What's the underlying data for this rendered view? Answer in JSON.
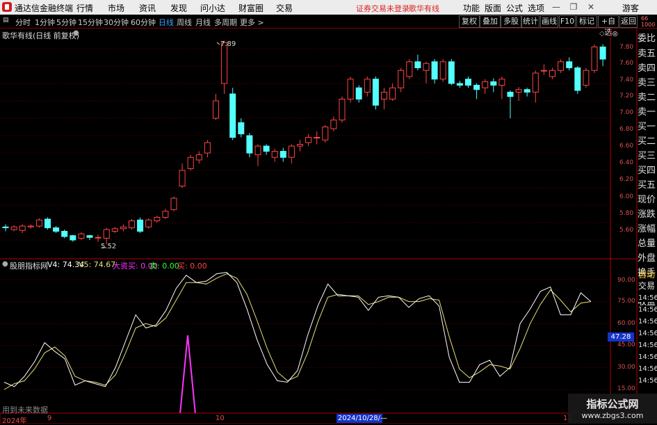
{
  "titlebar": {
    "app_title": "通达信金融终端",
    "menus": [
      "行情",
      "市场",
      "资讯",
      "发现",
      "问小达",
      "财富圈",
      "交易"
    ],
    "notice": "证券交易未登录",
    "stock_name": "歌华有线",
    "right_menus": [
      "功能",
      "版面",
      "公式",
      "选项"
    ],
    "user": "游客"
  },
  "toolbar": {
    "periods": [
      "分时",
      "1分钟",
      "5分钟",
      "15分钟",
      "30分钟",
      "60分钟",
      "日线",
      "周线",
      "月线",
      "多周期",
      "更多 >"
    ],
    "active_period": "日线",
    "right_buttons": [
      "复权",
      "叠加",
      "多股",
      "统计",
      "画线",
      "F10",
      "标记",
      "+自选",
      "返回"
    ]
  },
  "main_chart": {
    "caption": "歌华有线(日线 前复权)",
    "high_label": "7.89",
    "low_label": "5.52",
    "ytick_labels": [
      "7.80",
      "7.60",
      "7.40",
      "7.20",
      "7.00",
      "6.80",
      "6.60",
      "6.40",
      "6.20",
      "6.00",
      "5.80",
      "5.60"
    ]
  },
  "side_panel": {
    "labels": [
      "委比",
      "卖五",
      "卖四",
      "卖三",
      "卖二",
      "卖一",
      "买一",
      "买二",
      "买三",
      "买四",
      "买五",
      "现价",
      "涨跌",
      "涨幅",
      "总量",
      "外盘",
      "换手",
      "净资",
      "收益"
    ],
    "auto": "自动",
    "trade": "交易",
    "time_labels": [
      "14:56",
      "14:56",
      "14:56",
      "14:56",
      "14:56",
      "14:56",
      "14:56",
      "14:56"
    ]
  },
  "indicator": {
    "name": "股朋指标网",
    "v4_label": "V4: 74.34",
    "v5_label": "V5: 74.67",
    "big_buy": "大资买: 0.00",
    "sell": "卖: 0.00",
    "buy": "买: 0.00",
    "ytick_labels": [
      "90.00",
      "75.00",
      "60.00",
      "45.00",
      "30.00",
      "15.00"
    ],
    "current_value": "47.28",
    "footer": "用到未来数据"
  },
  "xaxis": {
    "labels": [
      "2024年",
      "9",
      "10",
      "2024/10/28/—",
      "12"
    ]
  },
  "watermark": {
    "title": "指标公式网",
    "url": "www.zbgs3.com"
  },
  "colors": {
    "up": "#ff4444",
    "down": "#54ffff",
    "v4": "#ffffff",
    "v5": "#e8e07a",
    "spike": "#ff33ff",
    "grid": "#6a0000"
  },
  "chart_data": {
    "type": "candlestick",
    "ylim": [
      5.5,
      7.95
    ],
    "candles": [
      {
        "o": 5.75,
        "c": 5.74,
        "h": 5.78,
        "l": 5.7
      },
      {
        "o": 5.72,
        "c": 5.75,
        "h": 5.77,
        "l": 5.7
      },
      {
        "o": 5.71,
        "c": 5.76,
        "h": 5.78,
        "l": 5.68
      },
      {
        "o": 5.75,
        "c": 5.76,
        "h": 5.78,
        "l": 5.73
      },
      {
        "o": 5.76,
        "c": 5.83,
        "h": 5.85,
        "l": 5.74
      },
      {
        "o": 5.84,
        "c": 5.74,
        "h": 5.86,
        "l": 5.72
      },
      {
        "o": 5.74,
        "c": 5.7,
        "h": 5.76,
        "l": 5.68
      },
      {
        "o": 5.7,
        "c": 5.64,
        "h": 5.72,
        "l": 5.62
      },
      {
        "o": 5.65,
        "c": 5.6,
        "h": 5.66,
        "l": 5.58
      },
      {
        "o": 5.62,
        "c": 5.67,
        "h": 5.69,
        "l": 5.6
      },
      {
        "o": 5.65,
        "c": 5.63,
        "h": 5.66,
        "l": 5.6
      },
      {
        "o": 5.63,
        "c": 5.63,
        "h": 5.66,
        "l": 5.58
      },
      {
        "o": 5.62,
        "c": 5.72,
        "h": 5.74,
        "l": 5.55
      },
      {
        "o": 5.7,
        "c": 5.73,
        "h": 5.75,
        "l": 5.68
      },
      {
        "o": 5.73,
        "c": 5.75,
        "h": 5.78,
        "l": 5.7
      },
      {
        "o": 5.74,
        "c": 5.82,
        "h": 5.84,
        "l": 5.72
      },
      {
        "o": 5.83,
        "c": 5.7,
        "h": 5.86,
        "l": 5.68
      },
      {
        "o": 5.75,
        "c": 5.83,
        "h": 5.85,
        "l": 5.73
      },
      {
        "o": 5.82,
        "c": 5.86,
        "h": 5.88,
        "l": 5.8
      },
      {
        "o": 5.86,
        "c": 5.93,
        "h": 5.96,
        "l": 5.84
      },
      {
        "o": 5.95,
        "c": 6.08,
        "h": 6.1,
        "l": 5.93
      },
      {
        "o": 6.22,
        "c": 6.4,
        "h": 6.48,
        "l": 6.2
      },
      {
        "o": 6.42,
        "c": 6.55,
        "h": 6.58,
        "l": 6.4
      },
      {
        "o": 6.52,
        "c": 6.58,
        "h": 6.62,
        "l": 6.48
      },
      {
        "o": 6.6,
        "c": 6.72,
        "h": 6.75,
        "l": 6.55
      },
      {
        "o": 7.0,
        "c": 7.2,
        "h": 7.28,
        "l": 6.98
      },
      {
        "o": 7.4,
        "c": 7.87,
        "h": 7.89,
        "l": 7.28
      },
      {
        "o": 7.28,
        "c": 6.78,
        "h": 7.35,
        "l": 6.75
      },
      {
        "o": 6.95,
        "c": 6.82,
        "h": 7.0,
        "l": 6.78
      },
      {
        "o": 6.8,
        "c": 6.6,
        "h": 6.83,
        "l": 6.55
      },
      {
        "o": 6.58,
        "c": 6.68,
        "h": 6.7,
        "l": 6.45
      },
      {
        "o": 6.68,
        "c": 6.62,
        "h": 6.7,
        "l": 6.58
      },
      {
        "o": 6.55,
        "c": 6.62,
        "h": 6.65,
        "l": 6.5
      },
      {
        "o": 6.62,
        "c": 6.55,
        "h": 6.66,
        "l": 6.5
      },
      {
        "o": 6.55,
        "c": 6.68,
        "h": 6.7,
        "l": 6.48
      },
      {
        "o": 6.68,
        "c": 6.7,
        "h": 6.75,
        "l": 6.62
      },
      {
        "o": 6.72,
        "c": 6.78,
        "h": 6.82,
        "l": 6.68
      },
      {
        "o": 6.78,
        "c": 6.78,
        "h": 6.85,
        "l": 6.7
      },
      {
        "o": 6.75,
        "c": 6.9,
        "h": 6.92,
        "l": 6.72
      },
      {
        "o": 6.88,
        "c": 6.98,
        "h": 7.02,
        "l": 6.85
      },
      {
        "o": 6.98,
        "c": 7.22,
        "h": 7.25,
        "l": 6.95
      },
      {
        "o": 7.22,
        "c": 7.45,
        "h": 7.48,
        "l": 7.18
      },
      {
        "o": 7.35,
        "c": 7.22,
        "h": 7.38,
        "l": 7.18
      },
      {
        "o": 7.3,
        "c": 7.45,
        "h": 7.48,
        "l": 7.25
      },
      {
        "o": 7.45,
        "c": 7.15,
        "h": 7.48,
        "l": 7.1
      },
      {
        "o": 7.22,
        "c": 7.3,
        "h": 7.35,
        "l": 7.1
      },
      {
        "o": 7.22,
        "c": 7.35,
        "h": 7.4,
        "l": 7.2
      },
      {
        "o": 7.35,
        "c": 7.55,
        "h": 7.58,
        "l": 7.3
      },
      {
        "o": 7.48,
        "c": 7.65,
        "h": 7.68,
        "l": 7.45
      },
      {
        "o": 7.65,
        "c": 7.58,
        "h": 7.73,
        "l": 7.55
      },
      {
        "o": 7.55,
        "c": 7.63,
        "h": 7.65,
        "l": 7.4
      },
      {
        "o": 7.65,
        "c": 7.45,
        "h": 7.68,
        "l": 7.4
      },
      {
        "o": 7.45,
        "c": 7.65,
        "h": 7.68,
        "l": 7.42
      },
      {
        "o": 7.65,
        "c": 7.4,
        "h": 7.68,
        "l": 7.38
      },
      {
        "o": 7.4,
        "c": 7.38,
        "h": 7.43,
        "l": 7.35
      },
      {
        "o": 7.45,
        "c": 7.38,
        "h": 7.48,
        "l": 7.35
      },
      {
        "o": 7.38,
        "c": 7.33,
        "h": 7.4,
        "l": 7.22
      },
      {
        "o": 7.35,
        "c": 7.42,
        "h": 7.45,
        "l": 7.28
      },
      {
        "o": 7.42,
        "c": 7.38,
        "h": 7.46,
        "l": 7.3
      },
      {
        "o": 7.38,
        "c": 7.45,
        "h": 7.48,
        "l": 7.22
      },
      {
        "o": 7.3,
        "c": 7.25,
        "h": 7.32,
        "l": 7.0
      },
      {
        "o": 7.3,
        "c": 7.33,
        "h": 7.36,
        "l": 7.2
      },
      {
        "o": 7.33,
        "c": 7.3,
        "h": 7.35,
        "l": 7.25
      },
      {
        "o": 7.3,
        "c": 7.52,
        "h": 7.55,
        "l": 7.18
      },
      {
        "o": 7.55,
        "c": 7.55,
        "h": 7.62,
        "l": 7.5
      },
      {
        "o": 7.48,
        "c": 7.55,
        "h": 7.58,
        "l": 7.45
      },
      {
        "o": 7.55,
        "c": 7.65,
        "h": 7.68,
        "l": 7.52
      },
      {
        "o": 7.65,
        "c": 7.58,
        "h": 7.7,
        "l": 7.55
      },
      {
        "o": 7.58,
        "c": 7.32,
        "h": 7.6,
        "l": 7.28
      },
      {
        "o": 7.38,
        "c": 7.55,
        "h": 7.58,
        "l": 7.35
      },
      {
        "o": 7.55,
        "c": 7.82,
        "h": 7.85,
        "l": 7.52
      },
      {
        "o": 7.82,
        "c": 7.68,
        "h": 7.85,
        "l": 7.6
      }
    ],
    "v4": [
      20,
      17,
      24,
      34,
      47,
      41,
      36,
      18,
      21,
      19,
      17,
      30,
      48,
      66,
      57,
      59,
      69,
      84,
      93,
      88,
      89,
      94,
      95,
      88,
      70,
      49,
      32,
      21,
      20,
      28,
      52,
      72,
      87,
      79,
      79,
      78,
      69,
      78,
      79,
      78,
      71,
      77,
      79,
      72,
      37,
      20,
      20,
      32,
      35,
      24,
      30,
      60,
      70,
      82,
      85,
      66,
      66,
      81,
      75
    ],
    "v5": [
      15,
      19,
      21,
      29,
      40,
      44,
      38,
      24,
      21,
      20,
      18,
      25,
      40,
      57,
      60,
      58,
      64,
      76,
      88,
      88,
      87,
      91,
      94,
      91,
      80,
      62,
      43,
      27,
      21,
      24,
      40,
      61,
      78,
      80,
      79,
      79,
      73,
      75,
      78,
      78,
      75,
      75,
      77,
      76,
      51,
      29,
      23,
      27,
      32,
      31,
      29,
      43,
      60,
      73,
      83,
      76,
      68,
      74,
      75
    ],
    "spike": {
      "index": 21,
      "value": 52
    }
  }
}
